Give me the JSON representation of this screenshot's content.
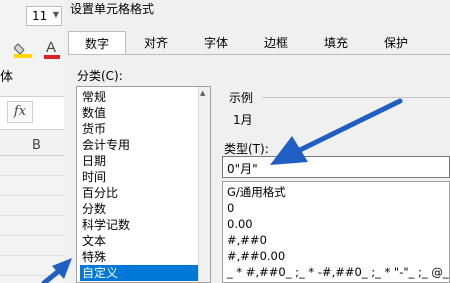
{
  "excel": {
    "font_size": "11",
    "ribbon_label": "体",
    "fx_label": "fx",
    "column_header": "B",
    "colors": {
      "font_color_bar": "#e02020",
      "fill_color": "#ffd700"
    }
  },
  "dialog": {
    "title": "设置单元格格式",
    "tabs": [
      "数字",
      "对齐",
      "字体",
      "边框",
      "填充",
      "保护"
    ],
    "active_tab": "数字",
    "category_label": "分类(C):",
    "categories": [
      "常规",
      "数值",
      "货币",
      "会计专用",
      "日期",
      "时间",
      "百分比",
      "分数",
      "科学记数",
      "文本",
      "特殊",
      "自定义"
    ],
    "selected_category": "自定义",
    "sample_label": "示例",
    "sample_value": "1月",
    "type_label": "类型(T):",
    "type_value": "0\"月\"",
    "format_list": [
      "G/通用格式",
      "0",
      "0.00",
      "#,##0",
      "#,##0.00",
      "_ * #,##0_ ;_ * -#,##0_ ;_ * \"-\"_ ;_ @_"
    ],
    "colors": {
      "accent": "#0078d7",
      "arrow": "#1f5fc4"
    }
  }
}
